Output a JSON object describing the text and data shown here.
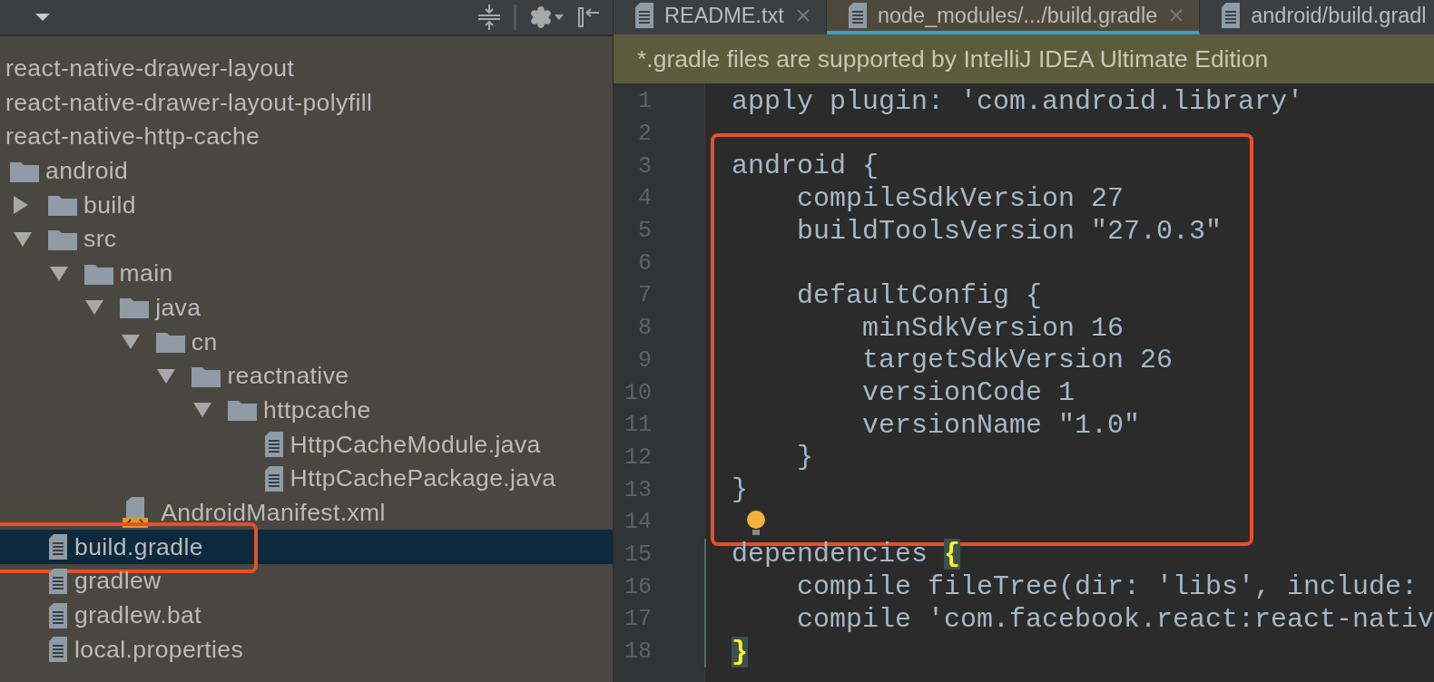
{
  "project_panel": {
    "tree": [
      {
        "kind": "library",
        "label": "react-native-drawer-layout",
        "selected": false
      },
      {
        "kind": "library",
        "label": "react-native-drawer-layout-polyfill",
        "selected": false
      },
      {
        "kind": "library",
        "label": "react-native-http-cache",
        "selected": false
      },
      {
        "kind": "folder",
        "label": "android",
        "selected": false,
        "children": [
          {
            "kind": "folder",
            "label": "build",
            "expanded": false,
            "selected": false
          },
          {
            "kind": "folder",
            "label": "src",
            "expanded": true,
            "selected": false,
            "children": [
              {
                "kind": "folder",
                "label": "main",
                "expanded": true,
                "selected": false,
                "children": [
                  {
                    "kind": "folder",
                    "label": "java",
                    "expanded": true,
                    "selected": false,
                    "children": [
                      {
                        "kind": "folder",
                        "label": "cn",
                        "expanded": true,
                        "selected": false,
                        "children": [
                          {
                            "kind": "folder",
                            "label": "reactnative",
                            "expanded": true,
                            "selected": false,
                            "children": [
                              {
                                "kind": "folder",
                                "label": "httpcache",
                                "expanded": true,
                                "selected": false,
                                "children": [
                                  {
                                    "kind": "file",
                                    "label": "HttpCacheModule.java",
                                    "selected": false
                                  },
                                  {
                                    "kind": "file",
                                    "label": "HttpCachePackage.java",
                                    "selected": false
                                  }
                                ]
                              }
                            ]
                          }
                        ]
                      }
                    ]
                  },
                  {
                    "kind": "manifest",
                    "label": "AndroidManifest.xml",
                    "selected": false
                  }
                ]
              }
            ]
          },
          {
            "kind": "file",
            "label": "build.gradle",
            "selected": true,
            "outlined": true
          },
          {
            "kind": "file",
            "label": "gradlew",
            "selected": false
          },
          {
            "kind": "file",
            "label": "gradlew.bat",
            "selected": false
          },
          {
            "kind": "file",
            "label": "local.properties",
            "selected": false
          }
        ]
      }
    ]
  },
  "editor": {
    "tabs": [
      {
        "label": "README.txt",
        "selected": false,
        "closable": true
      },
      {
        "label": "node_modules/.../build.gradle",
        "selected": true,
        "closable": true
      },
      {
        "label": "android/build.gradl",
        "selected": false
      }
    ],
    "banner": "*.gradle files are supported by IntelliJ IDEA Ultimate Edition",
    "blocks": [
      {
        "lines": [
          {
            "number": "1",
            "text": "apply plugin: 'com.android.library'"
          },
          {
            "number": "2"
          }
        ]
      },
      {
        "outlined": true,
        "lines": [
          {
            "number": "3",
            "text": "android {"
          },
          {
            "number": "4",
            "text": "    compileSdkVersion 27"
          },
          {
            "number": "5",
            "text": "    buildToolsVersion \"27.0.3\""
          },
          {
            "number": "6"
          },
          {
            "number": "7",
            "text": "    defaultConfig {"
          },
          {
            "number": "8",
            "text": "        minSdkVersion 16"
          },
          {
            "number": "9",
            "text": "        targetSdkVersion 26"
          },
          {
            "number": "10",
            "text": "        versionCode 1"
          },
          {
            "number": "11",
            "text": "        versionName \"1.0\""
          },
          {
            "number": "12",
            "text": "    }"
          },
          {
            "number": "13",
            "text": "}"
          },
          {
            "number": "14",
            "bulb": true
          }
        ]
      },
      {
        "lines": [
          {
            "number": "15",
            "text": "dependencies ",
            "brace": "{",
            "changed": true
          },
          {
            "number": "16",
            "text": "    compile fileTree(dir: 'libs', include: ",
            "changed": true
          },
          {
            "number": "17",
            "text": "    compile 'com.facebook.react:react-nativ",
            "changed": true
          },
          {
            "number": "18",
            "brace": "}",
            "changed": true
          }
        ]
      }
    ]
  }
}
